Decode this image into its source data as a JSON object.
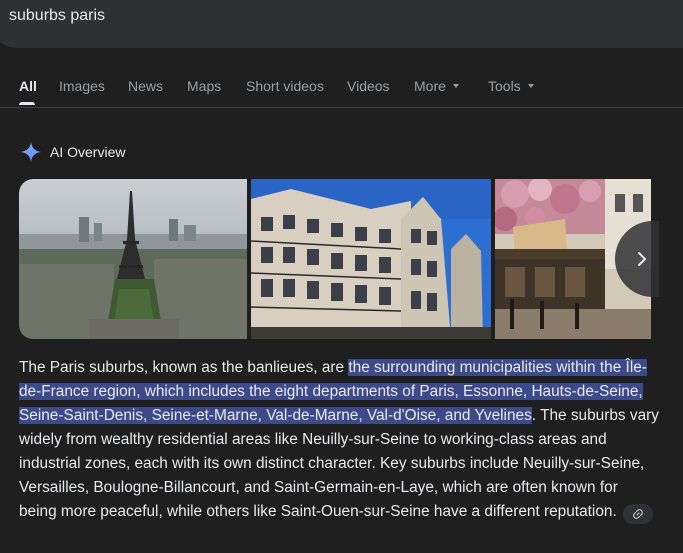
{
  "search": {
    "query": "suburbs paris"
  },
  "tabs": [
    {
      "label": "All"
    },
    {
      "label": "Images"
    },
    {
      "label": "News"
    },
    {
      "label": "Maps"
    },
    {
      "label": "Short videos"
    },
    {
      "label": "Videos"
    },
    {
      "label": "More"
    },
    {
      "label": "Tools"
    }
  ],
  "ai_overview": {
    "title": "AI Overview",
    "icon": "sparkle-icon",
    "images": [
      {
        "subject": "eiffel-tower-aerial-photo"
      },
      {
        "subject": "haussmann-building-photo"
      },
      {
        "subject": "paris-cafe-photo"
      }
    ],
    "text_before": "The Paris suburbs, known as the banlieues, are ",
    "text_highlight": "the surrounding municipalities within the Île-de-France region, which includes the eight departments of Paris, Essonne, Hauts-de-Seine, Seine-Saint-Denis, Seine-et-Marne, Val-de-Marne, Val-d'Oise, and Yvelines",
    "text_after": ". The suburbs vary widely from wealthy residential areas like Neuilly-sur-Seine to working-class areas and industrial zones, each with its own distinct character. Key suburbs include Neuilly-sur-Seine, Versailles, Boulogne-Billancourt, and Saint-Germain-en-Laye, which are often known for being more peaceful, while others like Saint-Ouen-sur-Seine have a different reputation."
  },
  "colors": {
    "highlight": "#3c4a8a",
    "background": "#1f1f1f",
    "accent_blue": "#4285f4"
  }
}
